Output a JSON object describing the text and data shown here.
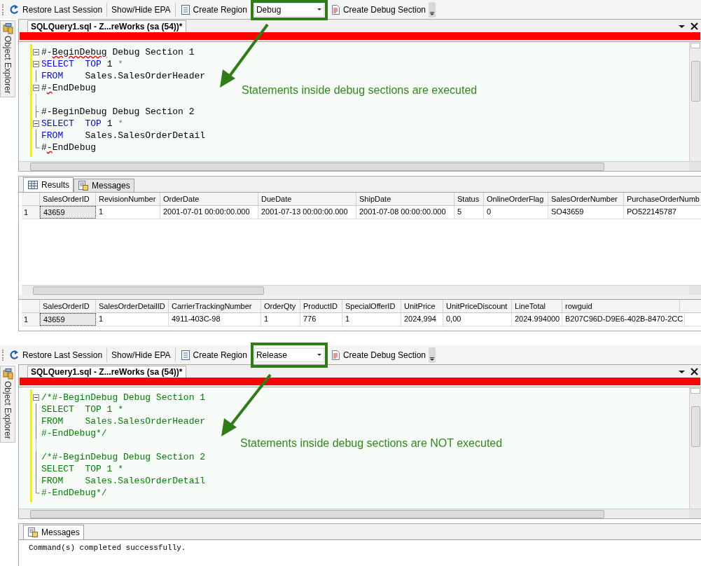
{
  "panels": [
    {
      "toolbar": {
        "items": [
          {
            "kind": "button",
            "label": "Restore Last Session"
          },
          {
            "kind": "separator"
          },
          {
            "kind": "button",
            "label": "Show/Hide EPA"
          },
          {
            "kind": "separator"
          },
          {
            "kind": "button",
            "label": "Create Region"
          },
          {
            "kind": "combo",
            "value": "Debug"
          },
          {
            "kind": "button",
            "label": "Create Debug Section"
          }
        ]
      },
      "side_tab": "Object Explorer",
      "document_tab": "SQLQuery1.sql - Z...reWorks (sa (54))*",
      "code_lines": [
        {
          "kind": "start",
          "tokens": [
            {
              "kind": "plain",
              "text": "#-"
            },
            {
              "kind": "plain",
              "text": "BeginDebug",
              "squiggle": true
            },
            {
              "kind": "plain",
              "text": " Debug Section 1"
            }
          ]
        },
        {
          "kind": "start",
          "tokens": [
            {
              "kind": "keyword",
              "text": "SELECT"
            },
            {
              "kind": "keyword",
              "text": "  TOP"
            },
            {
              "kind": "plain",
              "text": " 1 "
            },
            {
              "kind": "operator",
              "text": "*"
            }
          ]
        },
        {
          "kind": "body",
          "tokens": [
            {
              "kind": "keyword",
              "text": "FROM"
            },
            {
              "kind": "plain",
              "text": "    Sales.SalesOrderHeader"
            }
          ]
        },
        {
          "kind": "start",
          "tokens": [
            {
              "kind": "plain",
              "text": "#"
            },
            {
              "kind": "plain",
              "text": "-",
              "squiggle": true
            },
            {
              "kind": "plain",
              "text": "EndDebug"
            }
          ]
        },
        {
          "kind": "blank"
        },
        {
          "kind": "tick",
          "tokens": [
            {
              "kind": "plain",
              "text": "#-BeginDebug Debug Section 2"
            }
          ]
        },
        {
          "kind": "start",
          "tokens": [
            {
              "kind": "keyword",
              "text": "SELECT"
            },
            {
              "kind": "keyword",
              "text": "  TOP"
            },
            {
              "kind": "plain",
              "text": " 1 "
            },
            {
              "kind": "operator",
              "text": "*"
            }
          ]
        },
        {
          "kind": "body",
          "tokens": [
            {
              "kind": "keyword",
              "text": "FROM"
            },
            {
              "kind": "plain",
              "text": "    Sales.SalesOrderDetail"
            }
          ]
        },
        {
          "kind": "end",
          "tokens": [
            {
              "kind": "plain",
              "text": "#"
            },
            {
              "kind": "plain",
              "text": "-",
              "squiggle": true
            },
            {
              "kind": "plain",
              "text": "EndDebug"
            }
          ]
        }
      ],
      "annotation": "Statements inside debug sections are executed",
      "results": {
        "tabs": [
          {
            "label": "Results",
            "selected": true
          },
          {
            "label": "Messages",
            "selected": false
          }
        ],
        "grids": [
          {
            "columns": [
              "SalesOrderID",
              "RevisionNumber",
              "OrderDate",
              "DueDate",
              "ShipDate",
              "Status",
              "OnlineOrderFlag",
              "SalesOrderNumber",
              "PurchaseOrderNumb"
            ],
            "rows": [
              {
                "number": "1",
                "cells": [
                  {
                    "text": "43659",
                    "selected": true
                  },
                  {
                    "text": "1",
                    "selected": false
                  },
                  {
                    "text": "2001-07-01 00:00:00.000",
                    "selected": false
                  },
                  {
                    "text": "2001-07-13 00:00:00.000",
                    "selected": false
                  },
                  {
                    "text": "2001-07-08 00:00:00.000",
                    "selected": false
                  },
                  {
                    "text": "5",
                    "selected": false
                  },
                  {
                    "text": "0",
                    "selected": false
                  },
                  {
                    "text": "SO43659",
                    "selected": false
                  },
                  {
                    "text": "PO522145787",
                    "selected": false
                  }
                ]
              }
            ]
          },
          {
            "columns": [
              "SalesOrderID",
              "SalesOrderDetailID",
              "CarrierTrackingNumber",
              "OrderQty",
              "ProductID",
              "SpecialOfferID",
              "UnitPrice",
              "UnitPriceDiscount",
              "LineTotal",
              "rowguid"
            ],
            "rows": [
              {
                "number": "1",
                "cells": [
                  {
                    "text": "43659",
                    "selected": true
                  },
                  {
                    "text": "1",
                    "selected": false
                  },
                  {
                    "text": "4911-403C-98",
                    "selected": false
                  },
                  {
                    "text": "1",
                    "selected": false
                  },
                  {
                    "text": "776",
                    "selected": false
                  },
                  {
                    "text": "1",
                    "selected": false
                  },
                  {
                    "text": "2024,994",
                    "selected": false
                  },
                  {
                    "text": "0,00",
                    "selected": false
                  },
                  {
                    "text": "2024.994000",
                    "selected": false
                  },
                  {
                    "text": "B207C96D-D9E6-402B-8470-2CC",
                    "selected": false
                  }
                ]
              }
            ]
          }
        ]
      }
    },
    {
      "toolbar": {
        "items": [
          {
            "kind": "button",
            "label": "Restore Last Session"
          },
          {
            "kind": "separator"
          },
          {
            "kind": "button",
            "label": "Show/Hide EPA"
          },
          {
            "kind": "separator"
          },
          {
            "kind": "button",
            "label": "Create Region"
          },
          {
            "kind": "combo",
            "value": "Release"
          },
          {
            "kind": "button",
            "label": "Create Debug Section"
          }
        ]
      },
      "side_tab": "Object Explorer",
      "document_tab": "SQLQuery1.sql - Z...reWorks (sa (54))*",
      "code_lines": [
        {
          "kind": "start",
          "tokens": [
            {
              "kind": "comment",
              "text": "/*#-BeginDebug Debug Section 1"
            }
          ]
        },
        {
          "kind": "body",
          "tokens": [
            {
              "kind": "comment",
              "text": "SELECT  TOP 1 *"
            }
          ]
        },
        {
          "kind": "body",
          "tokens": [
            {
              "kind": "comment",
              "text": "FROM    Sales.SalesOrderHeader"
            }
          ]
        },
        {
          "kind": "body",
          "tokens": [
            {
              "kind": "comment",
              "text": "#-EndDebug*/"
            }
          ]
        },
        {
          "kind": "blank"
        },
        {
          "kind": "body",
          "tokens": [
            {
              "kind": "comment",
              "text": "/*#-BeginDebug Debug Section 2"
            }
          ]
        },
        {
          "kind": "body",
          "tokens": [
            {
              "kind": "comment",
              "text": "SELECT  TOP 1 *"
            }
          ]
        },
        {
          "kind": "body",
          "tokens": [
            {
              "kind": "comment",
              "text": "FROM    Sales.SalesOrderDetail"
            }
          ]
        },
        {
          "kind": "end",
          "tokens": [
            {
              "kind": "comment",
              "text": "#-EndDebug*/"
            }
          ]
        }
      ],
      "annotation": "Statements inside debug sections are NOT executed",
      "results": {
        "tabs": [
          {
            "label": "Messages",
            "selected": true
          }
        ],
        "message": "Command(s) completed successfully."
      }
    }
  ]
}
